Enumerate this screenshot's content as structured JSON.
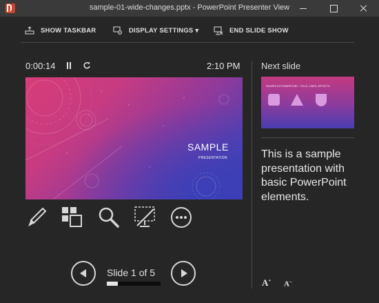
{
  "window": {
    "title": "sample-01-wide-changes.pptx - PowerPoint Presenter View",
    "icons": [
      "powerpoint-icon",
      "minimize-icon",
      "maximize-icon",
      "close-icon"
    ]
  },
  "toolbar": {
    "show_taskbar": "SHOW TASKBAR",
    "display_settings": "DISPLAY SETTINGS ▾",
    "end_slide_show": "END SLIDE SHOW"
  },
  "presenter": {
    "elapsed_time": "0:00:14",
    "clock": "2:10 PM"
  },
  "current_slide": {
    "title": "SAMPLE",
    "subtitle": "PRESENTATION"
  },
  "tools": [
    "pen-icon",
    "see-all-slides-icon",
    "zoom-icon",
    "black-screen-icon",
    "more-options-icon"
  ],
  "navigation": {
    "slide_counter": "Slide 1 of 5",
    "progress_fraction": 0.2
  },
  "next_slide": {
    "label": "Next slide",
    "title": "SHAPES IN POWERPOINT - FILLS, LINES, EFFECTS"
  },
  "notes": {
    "text": "This is a sample presentation with basic PowerPoint elements."
  },
  "font_controls": {
    "increase": "A",
    "decrease": "A"
  },
  "colors": {
    "background": "#262626",
    "titlebar": "#3a3a3a",
    "slide_pink": "#d83d77",
    "slide_blue": "#3c3aa8"
  }
}
